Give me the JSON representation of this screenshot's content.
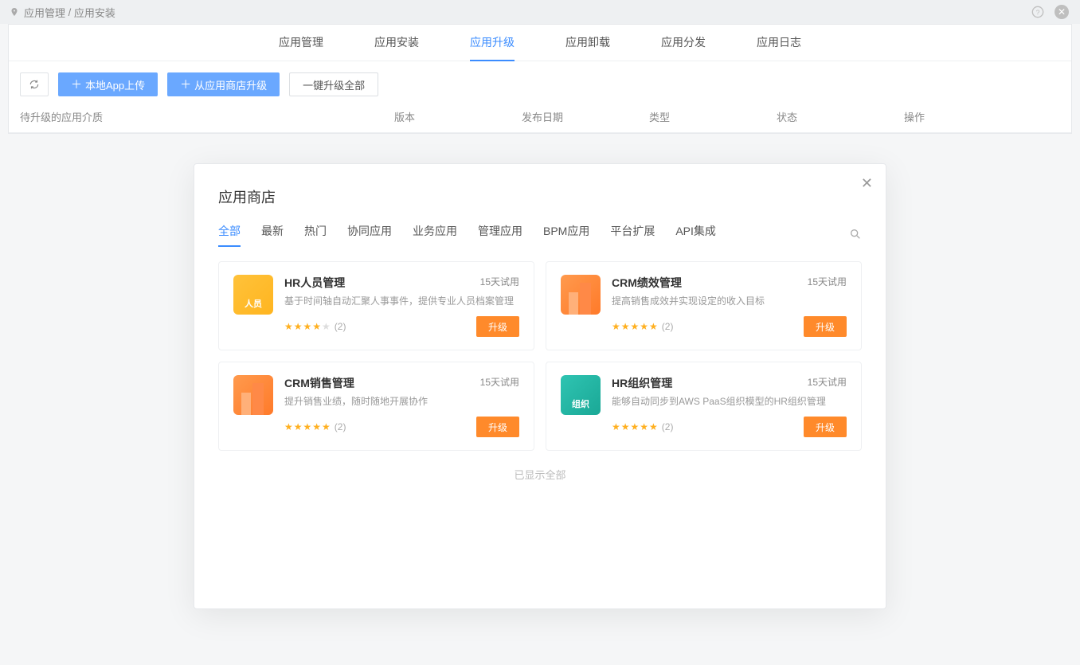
{
  "breadcrumb": {
    "parent": "应用管理",
    "current": "应用安装"
  },
  "nav": [
    "应用管理",
    "应用安装",
    "应用升级",
    "应用卸载",
    "应用分发",
    "应用日志"
  ],
  "nav_active_index": 2,
  "toolbar": {
    "upload_label": "本地App上传",
    "from_store_label": "从应用商店升级",
    "upgrade_all_label": "一键升级全部"
  },
  "table_headers": [
    "待升级的应用介质",
    "版本",
    "发布日期",
    "类型",
    "状态",
    "操作"
  ],
  "modal": {
    "title": "应用商店",
    "tabs": [
      "全部",
      "最新",
      "热门",
      "协同应用",
      "业务应用",
      "管理应用",
      "BPM应用",
      "平台扩展",
      "API集成"
    ],
    "active_tab_index": 0,
    "all_shown_label": "已显示全部",
    "trial_label": "15天试用",
    "upgrade_label": "升级",
    "apps": [
      {
        "name": "HR人员管理",
        "desc": "基于时间轴自动汇聚人事事件，提供专业人员档案管理",
        "rating": 4,
        "count": "(2)",
        "icon": "yellow",
        "icon_label": "人员"
      },
      {
        "name": "CRM绩效管理",
        "desc": "提高销售成效并实现设定的收入目标",
        "rating": 5,
        "count": "(2)",
        "icon": "orange",
        "icon_label": ""
      },
      {
        "name": "CRM销售管理",
        "desc": "提升销售业绩，随时随地开展协作",
        "rating": 5,
        "count": "(2)",
        "icon": "orange",
        "icon_label": ""
      },
      {
        "name": "HR组织管理",
        "desc": "能够自动同步到AWS PaaS组织模型的HR组织管理",
        "rating": 5,
        "count": "(2)",
        "icon": "teal",
        "icon_label": "组织"
      }
    ]
  }
}
